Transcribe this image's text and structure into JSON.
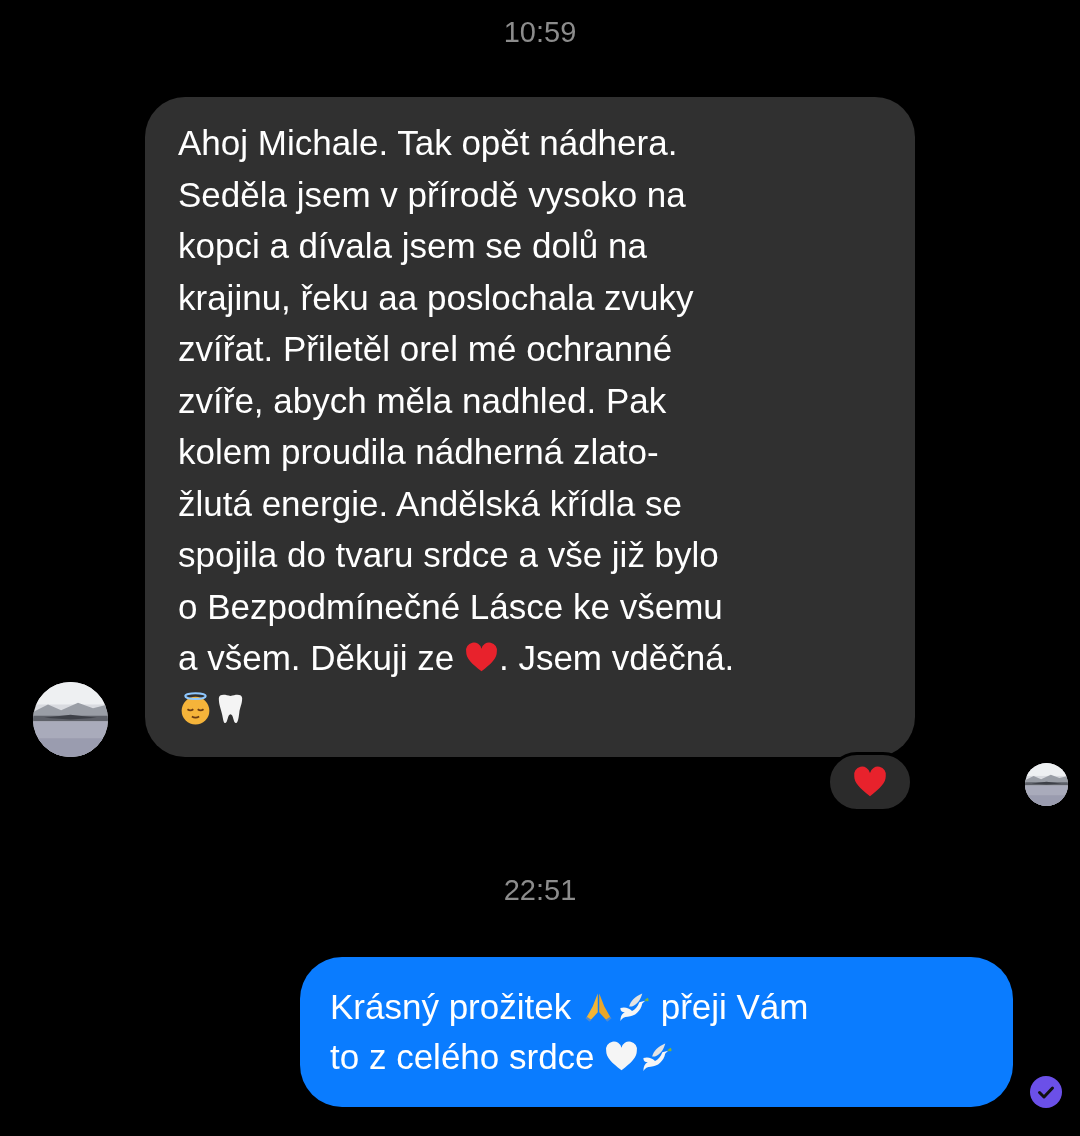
{
  "items": [
    {
      "kind": "time",
      "text": "10:59"
    },
    {
      "kind": "received",
      "reacted": true,
      "seen_avatar": true,
      "lines": [
        [
          "Ahoj Michale. Tak opět nádhera."
        ],
        [
          "Seděla jsem v přírodě vysoko na"
        ],
        [
          "kopci a dívala jsem se dolů na"
        ],
        [
          "krajinu, řeku aa poslochala zvuky"
        ],
        [
          "zvířat. Přiletěl orel mé ochranné"
        ],
        [
          "zvíře, abych měla nadhled. Pak"
        ],
        [
          "kolem proudila nádherná zlato-"
        ],
        [
          "žlutá energie. Andělská křídla se"
        ],
        [
          "spojila do tvaru srdce a vše již bylo"
        ],
        [
          "o Bezpodmínečné Lásce ke všemu"
        ],
        [
          "a všem. Děkuji ze ",
          {
            "kind": "red-heart"
          },
          ". Jsem vděčná."
        ],
        [
          {
            "kind": "halo-face"
          },
          {
            "kind": "tooth"
          }
        ]
      ]
    },
    {
      "kind": "time",
      "text": "22:51"
    },
    {
      "kind": "sent",
      "delivered": true,
      "lines": [
        [
          "Krásný prožitek ",
          {
            "kind": "pray"
          },
          {
            "kind": "dove"
          },
          " přeji Vám"
        ],
        [
          "to z celého srdce ",
          {
            "kind": "white-heart"
          },
          {
            "kind": "dove"
          }
        ]
      ]
    }
  ]
}
